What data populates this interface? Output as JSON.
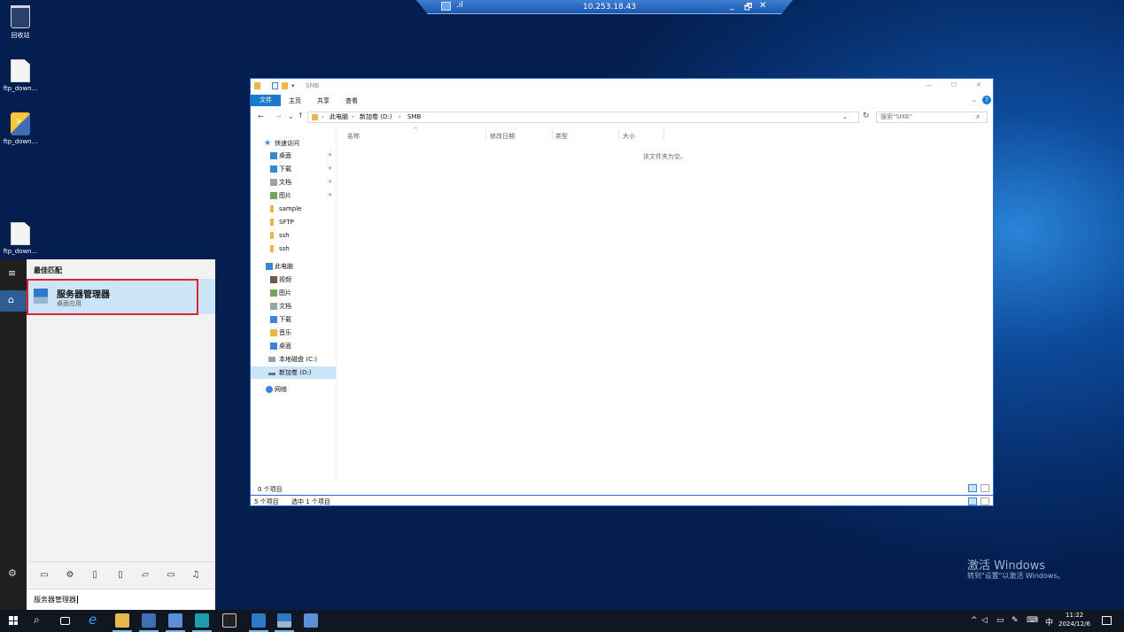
{
  "desktop": {
    "icons": [
      {
        "label": "回收站",
        "icon": "recycle-bin-icon"
      },
      {
        "label": "ftp_down...",
        "icon": "document-icon"
      },
      {
        "label": "ftp_down...",
        "icon": "python-script-icon"
      },
      {
        "label": "ftp_down...",
        "icon": "document-icon"
      }
    ],
    "watermark": {
      "title": "激活 Windows",
      "subtitle": "转到\"设置\"以激活 Windows。"
    }
  },
  "rdp_bar": {
    "host": "10.253.18.43",
    "signal": ".ıl",
    "min": "_",
    "restore": "🗗",
    "close": "✕"
  },
  "explorer": {
    "title": "SMB",
    "window_controls": {
      "min": "—",
      "max": "☐",
      "close": "✕"
    },
    "ribbon_tabs": [
      "文件",
      "主页",
      "共享",
      "查看"
    ],
    "help": "?",
    "address": {
      "segments": [
        "此电脑",
        "新加卷 (D:)",
        "SMB"
      ],
      "sep": "›"
    },
    "search_placeholder": "搜索\"SMB\"",
    "nav": {
      "quick_access": "快速访问",
      "pinned": [
        {
          "label": "桌面",
          "color": "#3a86d6"
        },
        {
          "label": "下载",
          "color": "#3a86d6"
        },
        {
          "label": "文档",
          "color": "#9aa3ad"
        },
        {
          "label": "图片",
          "color": "#6fa85a"
        }
      ],
      "folders": [
        "sample",
        "SFTP",
        "ssh",
        "ssh"
      ],
      "this_pc": "此电脑",
      "pc_items": [
        "视频",
        "图片",
        "文档",
        "下载",
        "音乐",
        "桌面",
        "本地磁盘 (C:)",
        "新加卷 (D:)"
      ],
      "network": "网络",
      "pin_glyph": "✈"
    },
    "columns": [
      "名称",
      "修改日期",
      "类型",
      "大小"
    ],
    "sort_arrow": "^",
    "empty_text": "该文件夹为空。",
    "status_inner": "0 个项目",
    "status_outer": [
      "5 个项目",
      "选中 1 个项目"
    ]
  },
  "start_menu": {
    "best_match_label": "最佳匹配",
    "result": {
      "title": "服务器管理器",
      "subtitle": "桌面应用"
    },
    "filter_icons": [
      "apps-icon",
      "settings-icon",
      "documents-icon",
      "folders-icon",
      "photos-icon",
      "videos-icon",
      "music-icon"
    ],
    "search_text": "服务器管理器",
    "rail": {
      "menu": "≡",
      "home": "⌂",
      "settings": "⚙"
    }
  },
  "taskbar": {
    "apps": [
      "start-icon",
      "search-icon",
      "task-view-icon",
      "ie-icon",
      "file-explorer-icon",
      "app-icon",
      "network-icon",
      "app-icon",
      "terminal-icon",
      "app-icon",
      "server-manager-icon",
      "network-icon"
    ],
    "tray": {
      "ime": "中",
      "time": "11:22",
      "date": "2024/12/6"
    }
  },
  "colors": {
    "accent": "#1979ca",
    "selection": "#cce4f7",
    "highlight_border": "#e0262b",
    "taskbar": "#101722"
  }
}
